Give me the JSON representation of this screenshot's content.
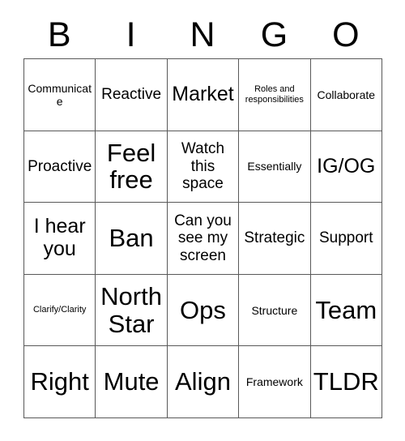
{
  "card": {
    "title": "BINGO",
    "headers": [
      "B",
      "I",
      "N",
      "G",
      "O"
    ],
    "colors": {
      "text": "#000000",
      "grid_line": "#595959",
      "background": "#ffffff"
    },
    "rows": [
      [
        {
          "text": "Communicate",
          "size": "sm"
        },
        {
          "text": "Reactive",
          "size": "md"
        },
        {
          "text": "Market",
          "size": "lg"
        },
        {
          "text": "Roles and responsibilities",
          "size": "xs"
        },
        {
          "text": "Collaborate",
          "size": "sm"
        }
      ],
      [
        {
          "text": "Proactive",
          "size": "md"
        },
        {
          "text": "Feel free",
          "size": "xl"
        },
        {
          "text": "Watch this space",
          "size": "md"
        },
        {
          "text": "Essentially",
          "size": "sm"
        },
        {
          "text": "IG/OG",
          "size": "lg"
        }
      ],
      [
        {
          "text": "I hear you",
          "size": "lg"
        },
        {
          "text": "Ban",
          "size": "xl"
        },
        {
          "text": "Can you see my screen",
          "size": "md"
        },
        {
          "text": "Strategic",
          "size": "md"
        },
        {
          "text": "Support",
          "size": "md"
        }
      ],
      [
        {
          "text": "Clarify/Clarity",
          "size": "xs"
        },
        {
          "text": "North Star",
          "size": "xl"
        },
        {
          "text": "Ops",
          "size": "xl"
        },
        {
          "text": "Structure",
          "size": "sm"
        },
        {
          "text": "Team",
          "size": "xl"
        }
      ],
      [
        {
          "text": "Right",
          "size": "xl"
        },
        {
          "text": "Mute",
          "size": "xl"
        },
        {
          "text": "Align",
          "size": "xl"
        },
        {
          "text": "Framework",
          "size": "sm"
        },
        {
          "text": "TLDR",
          "size": "xl"
        }
      ]
    ]
  }
}
